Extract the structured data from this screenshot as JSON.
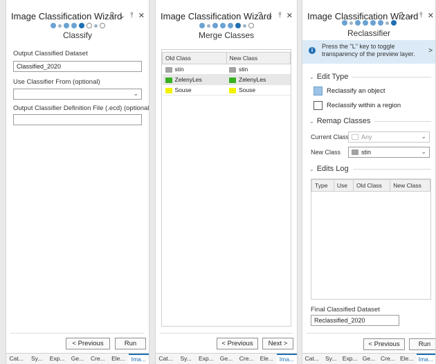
{
  "panel1": {
    "title": "Image Classification Wizard",
    "controls": [
      "?",
      "⌄",
      "⫯",
      "✕"
    ],
    "step_name": "Classify",
    "output_dataset_label": "Output Classified Dataset",
    "output_dataset_value": "Classified_2020",
    "use_classifier_label": "Use Classifier From (optional)",
    "use_classifier_value": "",
    "ecd_label": "Output Classifier Definition File (.ecd) (optional)",
    "ecd_value": "",
    "prev_label": "< Previous",
    "run_label": "Run"
  },
  "panel2": {
    "title": "Image Classification Wizard",
    "controls": [
      "?",
      "⌄",
      "⫯",
      "✕"
    ],
    "step_name": "Merge Classes",
    "columns": [
      "Old Class",
      "New Class"
    ],
    "rows": [
      {
        "old": "stin",
        "new": "stin",
        "old_color": "#a3a3a3",
        "new_color": "#a3a3a3"
      },
      {
        "old": "ZelenyLes",
        "new": "ZelenyLes",
        "old_color": "#38b021",
        "new_color": "#38b021"
      },
      {
        "old": "Souse",
        "new": "Souse",
        "old_color": "#f2f200",
        "new_color": "#f2f200"
      }
    ],
    "prev_label": "< Previous",
    "next_label": "Next >"
  },
  "panel3": {
    "title": "Image Classification Wizard",
    "controls": [
      "?",
      "⌄",
      "⫯",
      "✕"
    ],
    "step_name": "Reclassifier",
    "info_text": "Press the \"L\" key to toggle transparency of the preview layer.",
    "edit_type_label": "Edit Type",
    "reclassify_object": "Reclassify an object",
    "reclassify_region": "Reclassify within a region",
    "remap_label": "Remap Classes",
    "current_class_label": "Current Class",
    "current_class_value": "Any",
    "new_class_label": "New Class",
    "new_class_value": "stin",
    "edits_log_label": "Edits Log",
    "log_columns": [
      "Type",
      "Use",
      "Old Class",
      "New Class"
    ],
    "final_dataset_label": "Final Classified Dataset",
    "final_dataset_value": "Reclassified_2020",
    "prev_label": "< Previous",
    "run_label": "Run"
  },
  "tabs": [
    "Cat...",
    "Sy...",
    "Exp...",
    "Ge...",
    "Cre...",
    "Ele...",
    "Ima..."
  ],
  "colors": {
    "accent": "#1f6fb3",
    "stin": "#a3a3a3",
    "zelenyles": "#38b021",
    "souse": "#f2f200"
  }
}
